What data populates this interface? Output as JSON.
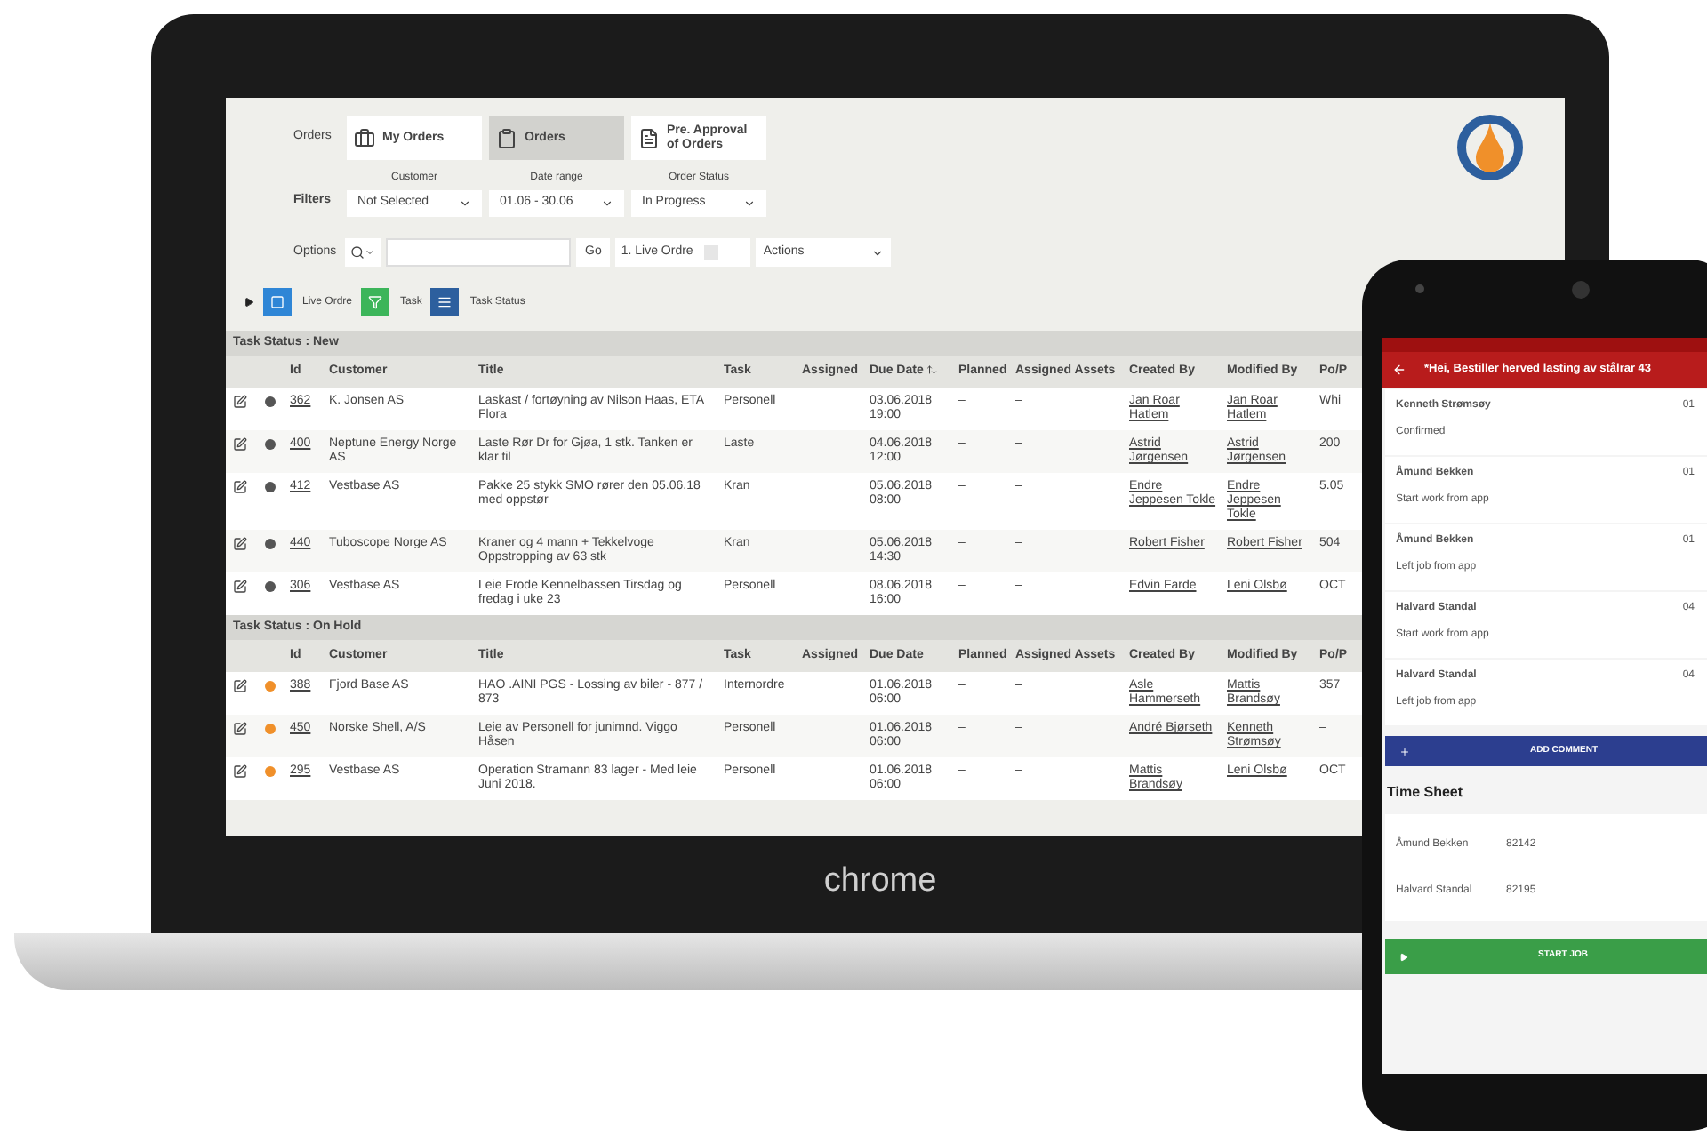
{
  "laptop": {
    "brand": "chrome",
    "orders": {
      "label": "Orders",
      "tabs": [
        {
          "label": "My Orders",
          "selected": false
        },
        {
          "label": "Orders",
          "selected": true
        },
        {
          "label": "Pre. Approval of Orders",
          "selected": false
        }
      ]
    },
    "filters": {
      "label": "Filters",
      "items": [
        {
          "caption": "Customer",
          "value": "Not Selected"
        },
        {
          "caption": "Date range",
          "value": "01.06 - 30.06"
        },
        {
          "caption": "Order Status",
          "value": "In Progress"
        }
      ]
    },
    "options": {
      "label": "Options",
      "go": "Go",
      "live": "1. Live Ordre",
      "actions": "Actions"
    },
    "toolbar": [
      {
        "kind": "live",
        "label": "Live Ordre"
      },
      {
        "kind": "task",
        "label": "Task"
      },
      {
        "kind": "status",
        "label": "Task Status"
      }
    ],
    "sections": [
      {
        "title": "Task Status : New",
        "columns": [
          "Id",
          "Customer",
          "Title",
          "Task",
          "Assigned",
          "Due Date",
          "Planned",
          "Assigned Assets",
          "Created By",
          "Modified By",
          "Po/P"
        ],
        "rows": [
          {
            "color": "#555555",
            "id": "362",
            "customer": "K. Jonsen AS",
            "title": "Laskast / fortøyning av Nilson Haas, ETA Flora",
            "task": "Personell",
            "due": "03.06.2018 19:00",
            "planned": "–",
            "assets": "–",
            "created": "Jan Roar Hatlem",
            "modified": "Jan Roar Hatlem",
            "po": "Whi"
          },
          {
            "color": "#555555",
            "id": "400",
            "customer": "Neptune Energy Norge AS",
            "title": "Laste Rør Dr for Gjøa, 1 stk. Tanken er klar til",
            "task": "Laste",
            "due": "04.06.2018 12:00",
            "planned": "–",
            "assets": "–",
            "created": "Astrid Jørgensen",
            "modified": "Astrid Jørgensen",
            "po": "200"
          },
          {
            "color": "#555555",
            "id": "412",
            "customer": "Vestbase AS",
            "title": "Pakke 25 stykk SMO rører den 05.06.18 med oppstør",
            "task": "Kran",
            "due": "05.06.2018 08:00",
            "planned": "–",
            "assets": "–",
            "created": "Endre Jeppesen Tokle",
            "modified": "Endre Jeppesen Tokle",
            "po": "5.05"
          },
          {
            "color": "#555555",
            "id": "440",
            "customer": "Tuboscope Norge AS",
            "title": "Kraner og 4 mann + Tekkelvoge Oppstropping av 63 stk",
            "task": "Kran",
            "due": "05.06.2018 14:30",
            "planned": "–",
            "assets": "–",
            "created": "Robert Fisher",
            "modified": "Robert Fisher",
            "po": "504"
          },
          {
            "color": "#555555",
            "id": "306",
            "customer": "Vestbase AS",
            "title": "Leie Frode Kennelbassen Tirsdag og fredag i uke 23",
            "task": "Personell",
            "due": "08.06.2018 16:00",
            "planned": "–",
            "assets": "–",
            "created": "Edvin Farde",
            "modified": "Leni Olsbø",
            "po": "OCT"
          }
        ]
      },
      {
        "title": "Task Status : On Hold",
        "columns": [
          "Id",
          "Customer",
          "Title",
          "Task",
          "Assigned",
          "Due Date",
          "Planned",
          "Assigned Assets",
          "Created By",
          "Modified By",
          "Po/P"
        ],
        "rows": [
          {
            "color": "#f0902a",
            "id": "388",
            "customer": "Fjord Base AS",
            "title": "HAO .AINI PGS - Lossing av biler - 877 / 873",
            "task": "Internordre",
            "due": "01.06.2018 06:00",
            "planned": "–",
            "assets": "–",
            "created": "Asle Hammerseth",
            "modified": "Mattis Brandsøy",
            "po": "357"
          },
          {
            "color": "#f0902a",
            "id": "450",
            "customer": "Norske Shell, A/S",
            "title": "Leie av Personell for junimnd. Viggo Håsen",
            "task": "Personell",
            "due": "01.06.2018 06:00",
            "planned": "–",
            "assets": "–",
            "created": "André Bjørseth",
            "modified": "Kenneth Strømsøy",
            "po": "–"
          },
          {
            "color": "#f0902a",
            "id": "295",
            "customer": "Vestbase AS",
            "title": "Operation Stramann 83 lager - Med leie Juni 2018.",
            "task": "Personell",
            "due": "01.06.2018 06:00",
            "planned": "–",
            "assets": "–",
            "created": "Mattis Brandsøy",
            "modified": "Leni Olsbø",
            "po": "OCT"
          }
        ]
      }
    ]
  },
  "phone": {
    "title": "*Hei, Bestiller herved lasting av stålrar 43",
    "entries": [
      {
        "name": "Kenneth Strømsøy",
        "date": "01",
        "note": "Confirmed"
      },
      {
        "name": "Åmund Bekken",
        "date": "01",
        "note": "Start work from app"
      },
      {
        "name": "Åmund Bekken",
        "date": "01",
        "note": "Left job from app"
      },
      {
        "name": "Halvard Standal",
        "date": "04",
        "note": "Start work from app"
      },
      {
        "name": "Halvard Standal",
        "date": "04",
        "note": "Left job from app"
      }
    ],
    "add_comment": "ADD COMMENT",
    "timesheet": {
      "title": "Time Sheet",
      "rows": [
        {
          "name": "Åmund Bekken",
          "value": "82142"
        },
        {
          "name": "Halvard Standal",
          "value": "82195"
        }
      ]
    },
    "start_job": "START JOB"
  }
}
